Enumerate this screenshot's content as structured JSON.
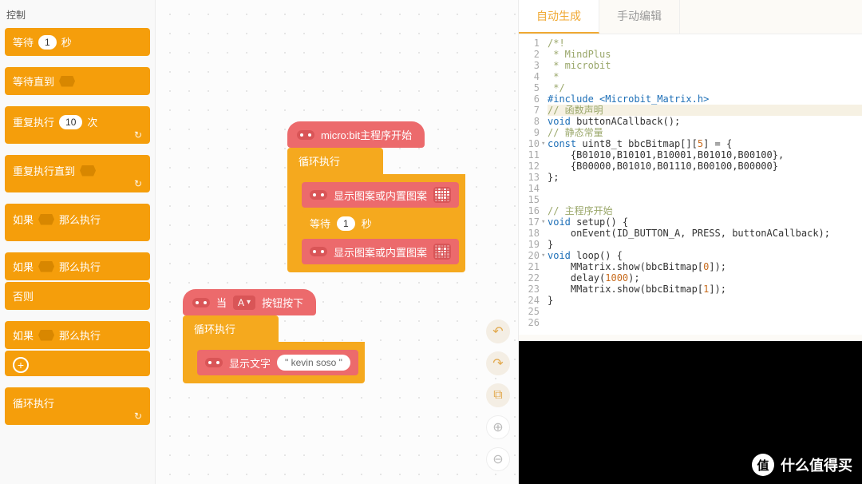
{
  "palette": {
    "header": "控制",
    "blocks": {
      "wait_secs": {
        "pre": "等待",
        "num": "1",
        "suf": "秒"
      },
      "wait_until": {
        "pre": "等待直到"
      },
      "repeat_n": {
        "pre": "重复执行",
        "num": "10",
        "suf": "次"
      },
      "repeat_until": {
        "pre": "重复执行直到"
      },
      "if_then": {
        "pre": "如果",
        "suf": "那么执行"
      },
      "if_then2": {
        "pre": "如果",
        "suf": "那么执行"
      },
      "else": {
        "label": "否则"
      },
      "if_then3": {
        "pre": "如果",
        "suf": "那么执行"
      },
      "forever": {
        "label": "循环执行"
      }
    }
  },
  "canvas": {
    "hat1": "micro:bit主程序开始",
    "forever": "循环执行",
    "show_pattern": "显示图案或内置图案",
    "wait": {
      "pre": "等待",
      "num": "1",
      "suf": "秒"
    },
    "hat2": {
      "pre": "当",
      "sel": "A",
      "suf": "按钮按下"
    },
    "show_text": {
      "label": "显示文字",
      "value": "\" kevin soso \""
    }
  },
  "tabs": {
    "auto": "自动生成",
    "manual": "手动编辑"
  },
  "code": [
    {
      "n": 1,
      "kind": "cmt",
      "text": "/*!"
    },
    {
      "n": 2,
      "kind": "cmt",
      "text": " * MindPlus"
    },
    {
      "n": 3,
      "kind": "cmt",
      "text": " * microbit"
    },
    {
      "n": 4,
      "kind": "cmt",
      "text": " *"
    },
    {
      "n": 5,
      "kind": "cmt",
      "text": " */"
    },
    {
      "n": 6,
      "kind": "inc",
      "text": "#include <Microbit_Matrix.h>"
    },
    {
      "n": 7,
      "kind": "cmt",
      "text": "// 函数声明",
      "hl": true
    },
    {
      "n": 8,
      "kind": "decl",
      "text": "void buttonACallback();"
    },
    {
      "n": 9,
      "kind": "cmt",
      "text": "// 静态常量"
    },
    {
      "n": 10,
      "kind": "decl2",
      "text": "const uint8_t bbcBitmap[][5] = {",
      "fold": true
    },
    {
      "n": 11,
      "kind": "plain",
      "text": "    {B01010,B10101,B10001,B01010,B00100},"
    },
    {
      "n": 12,
      "kind": "plain",
      "text": "    {B00000,B01010,B01110,B00100,B00000}"
    },
    {
      "n": 13,
      "kind": "plain",
      "text": "};"
    },
    {
      "n": 14,
      "kind": "plain",
      "text": ""
    },
    {
      "n": 15,
      "kind": "plain",
      "text": ""
    },
    {
      "n": 16,
      "kind": "cmt",
      "text": "// 主程序开始"
    },
    {
      "n": 17,
      "kind": "fn",
      "text": "void setup() {",
      "fold": true
    },
    {
      "n": 18,
      "kind": "call",
      "text": "    onEvent(ID_BUTTON_A, PRESS, buttonACallback);"
    },
    {
      "n": 19,
      "kind": "plain",
      "text": "}"
    },
    {
      "n": 20,
      "kind": "fn",
      "text": "void loop() {",
      "fold": true
    },
    {
      "n": 21,
      "kind": "call2",
      "text": "    MMatrix.show(bbcBitmap[0]);"
    },
    {
      "n": 22,
      "kind": "call3",
      "text": "    delay(1000);"
    },
    {
      "n": 23,
      "kind": "call2",
      "text": "    MMatrix.show(bbcBitmap[1]);"
    },
    {
      "n": 24,
      "kind": "plain",
      "text": "}"
    },
    {
      "n": 25,
      "kind": "plain",
      "text": ""
    },
    {
      "n": 26,
      "kind": "plain",
      "text": ""
    }
  ],
  "watermark": {
    "badge": "值",
    "text": "什么值得买"
  }
}
